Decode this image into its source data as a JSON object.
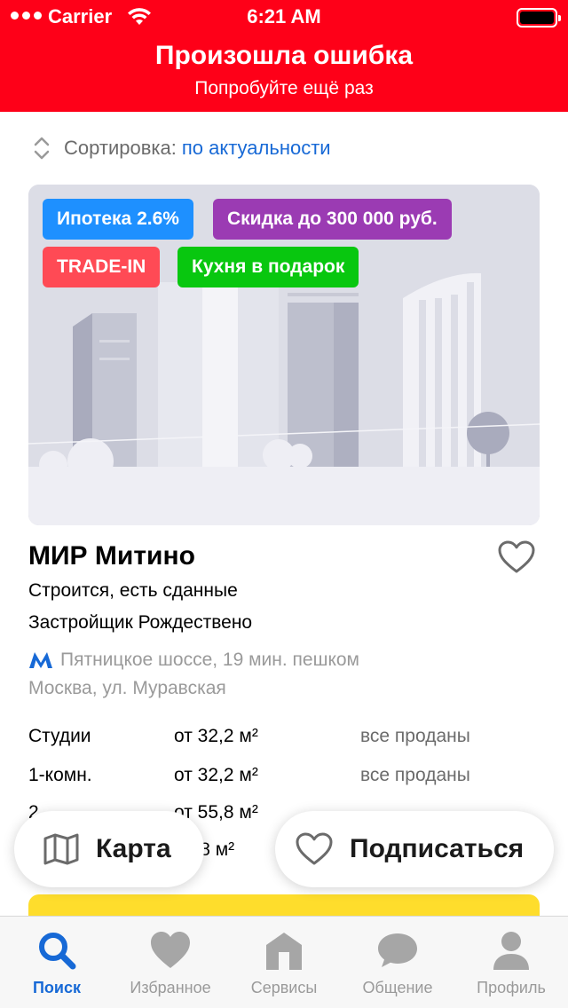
{
  "status_bar": {
    "carrier": "Carrier",
    "time": "6:21 AM"
  },
  "error_banner": {
    "title": "Произошла ошибка",
    "subtitle": "Попробуйте ещё раз"
  },
  "sort": {
    "label": "Сортировка:",
    "value": "по актуальности"
  },
  "card": {
    "badges": [
      {
        "label": "Ипотека 2.6%",
        "color": "#1e90ff"
      },
      {
        "label": "Скидка до 300 000 руб.",
        "color": "#9b3bb3"
      },
      {
        "label": "TRADE-IN",
        "color": "#ff4a55"
      },
      {
        "label": "Кухня в подарок",
        "color": "#08c70f"
      }
    ],
    "title": "МИР Митино",
    "status": "Строится, есть сданные",
    "developer": "Застройщик Рождествено",
    "metro": "Пятницкое шоссе, 19 мин. пешком",
    "address": "Москва, ул. Муравская",
    "apartments": [
      {
        "type": "Студии",
        "area": "от 32,2 м²",
        "status": "все проданы"
      },
      {
        "type": "1-комн.",
        "area": "от 32,2 м²",
        "status": "все проданы"
      },
      {
        "type": "2",
        "area": "от 55,8 м²",
        "status": ""
      },
      {
        "type": "",
        "area": "69,8 м²",
        "status": ""
      }
    ],
    "metro_color": "#1769d6"
  },
  "floating": {
    "map_label": "Карта",
    "subscribe_label": "Подписаться"
  },
  "tabs": [
    {
      "label": "Поиск",
      "icon": "search-icon",
      "active": true
    },
    {
      "label": "Избранное",
      "icon": "heart-icon",
      "active": false
    },
    {
      "label": "Сервисы",
      "icon": "home-icon",
      "active": false
    },
    {
      "label": "Общение",
      "icon": "chat-icon",
      "active": false
    },
    {
      "label": "Профиль",
      "icon": "profile-icon",
      "active": false
    }
  ],
  "colors": {
    "accent": "#1769d6",
    "error": "#fe0018",
    "cta": "#fedd2c"
  }
}
